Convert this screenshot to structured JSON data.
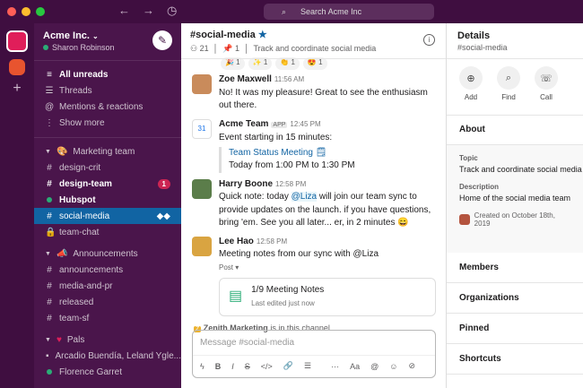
{
  "window": {
    "search_placeholder": "Search Acme Inc"
  },
  "workspace": {
    "name": "Acme Inc.",
    "user": "Sharon Robinson"
  },
  "sidebar": {
    "top": [
      {
        "label": "All unreads",
        "bold": true
      },
      {
        "label": "Threads"
      },
      {
        "label": "Mentions & reactions"
      },
      {
        "label": "Show more"
      }
    ],
    "marketing": {
      "label": "Marketing team",
      "items": [
        {
          "label": "design-crit"
        },
        {
          "label": "design-team",
          "badge": "1"
        },
        {
          "label": "Hubspot"
        },
        {
          "label": "social-media"
        },
        {
          "label": "team-chat"
        }
      ]
    },
    "announcements": {
      "label": "Announcements",
      "items": [
        {
          "label": "announcements"
        },
        {
          "label": "media-and-pr"
        },
        {
          "label": "released"
        },
        {
          "label": "team-sf"
        }
      ]
    },
    "pals": {
      "label": "Pals",
      "items": [
        {
          "label": "Arcadio Buendía, Leland Ygle..."
        },
        {
          "label": "Florence Garret"
        }
      ]
    }
  },
  "channel": {
    "name": "#social-media",
    "members": "21",
    "pins": "1",
    "topic": "Track and coordinate social media"
  },
  "reactions": [
    "🎉 1",
    "✨ 1",
    "👏 1",
    "😍 1"
  ],
  "messages": [
    {
      "name": "Zoe Maxwell",
      "time": "11:56 AM",
      "text": "No! It was my pleasure! Great to see the enthusiasm out there."
    },
    {
      "name": "Acme Team",
      "tag": "APP",
      "time": "12:45 PM",
      "text": "Event starting in 15 minutes:",
      "quote_title": "Team Status Meeting 🗒",
      "quote_text": "Today from 1:00 PM to 1:30 PM"
    },
    {
      "name": "Harry Boone",
      "time": "12:58 PM",
      "text_a": "Quick note: today ",
      "mention": "@Liza",
      "text_b": " will join our team sync to provide updates on the launch. if you have questions, bring 'em. See you all later... er, in 2 minutes 😄"
    },
    {
      "name": "Lee Hao",
      "time": "12:58 PM",
      "text": "Meeting notes from our sync with @Liza",
      "post_label": "Post ▾",
      "card_title": "1/9 Meeting Notes",
      "card_sub": "Last edited just now"
    }
  ],
  "channel_note": {
    "who": "Zenith Marketing",
    "rest": " is in this channel"
  },
  "composer": {
    "placeholder": "Message #social-media"
  },
  "details": {
    "title": "Details",
    "sub": "#social-media",
    "actions": [
      {
        "label": "Add"
      },
      {
        "label": "Find"
      },
      {
        "label": "Call"
      }
    ],
    "about": "About",
    "topic_label": "Topic",
    "topic": "Track and coordinate social media",
    "desc_label": "Description",
    "desc": "Home of the social media team",
    "created": "Created on October 18th, 2019",
    "rows": [
      "Members",
      "Organizations",
      "Pinned",
      "Shortcuts"
    ]
  },
  "colors": {
    "aubergine": "#3f0e40",
    "sidebar": "#4a154b",
    "active": "#1164a3"
  }
}
